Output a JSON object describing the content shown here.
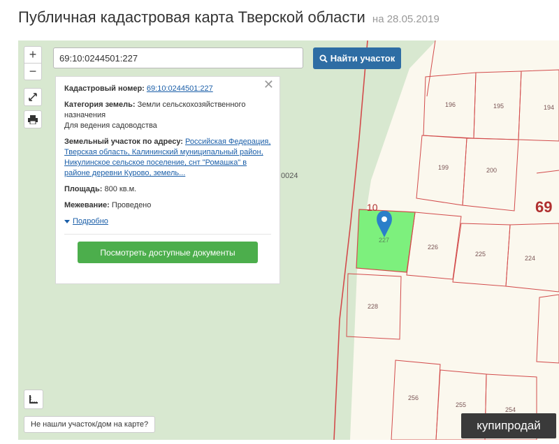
{
  "header": {
    "title": "Публичная кадастровая карта Тверской области",
    "date": "на 28.05.2019"
  },
  "search": {
    "value": "69:10:0244501:227",
    "button_label": "Найти участок"
  },
  "controls": {
    "zoom_in": "+",
    "zoom_out": "−"
  },
  "info": {
    "cadastral_label": "Кадастровый номер:",
    "cadastral_value": "69:10:0244501:227",
    "category_label": "Категория земель:",
    "category_value": "Земли сельскохозяйственного назначения",
    "category_use": "Для ведения садоводства",
    "address_label": "Земельный участок по адресу:",
    "address_value": "Российская Федерация, Тверская область, Калининский муниципальный район, Никулинское сельское поселение, снт \"Ромашка\" в районе деревни Курово, земель...",
    "area_label": "Площадь:",
    "area_value": "800 кв.м.",
    "survey_label": "Межевание:",
    "survey_value": "Проведено",
    "more_link": "Подробно",
    "docs_button": "Посмотреть доступные документы"
  },
  "map": {
    "labels": {
      "p196": "196",
      "p195": "195",
      "p194": "194",
      "p199": "199",
      "p200": "200",
      "p226": "226",
      "p225": "225",
      "p224": "224",
      "p227": "227",
      "p228": "228",
      "p256": "256",
      "p255": "255",
      "p254": "254",
      "block_69": "69",
      "block_10": "10",
      "block_0024": "0024"
    }
  },
  "footer": {
    "not_found": "Не нашли участок/дом на карте?"
  },
  "watermark": "купипродай",
  "colors": {
    "map_background": "#d8e8d0",
    "plot_border": "#d24b4b",
    "selected_plot": "#7df07d",
    "search_button": "#2e6da4",
    "docs_button": "#4cae4c",
    "marker": "#2b7fc9"
  }
}
